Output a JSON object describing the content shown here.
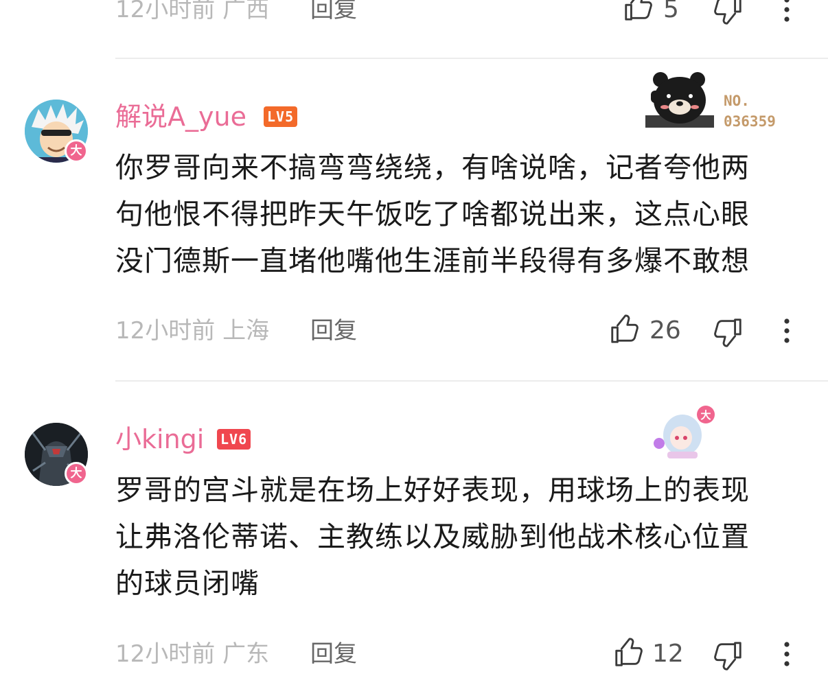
{
  "prev_comment": {
    "time": "12小时前",
    "location": "广西",
    "reply_label": "回复",
    "like_count": "5"
  },
  "comments": [
    {
      "username": "解说A_yue",
      "level": "LV5",
      "vip_badge": "大",
      "fan_label": "NO.",
      "fan_number": "036359",
      "lines": [
        "你罗哥向来不搞弯弯绕绕，有啥说啥，记者夸他两",
        "句他恨不得把昨天午饭吃了啥都说出来，这点心眼",
        "没门德斯一直堵他嘴他生涯前半段得有多爆不敢想"
      ],
      "time": "12小时前",
      "location": "上海",
      "reply_label": "回复",
      "like_count": "26"
    },
    {
      "username": "小kingi",
      "level": "LV6",
      "vip_badge": "大",
      "lines": [
        "罗哥的宫斗就是在场上好好表现，用球场上的表现",
        "让弗洛伦蒂诺、主教练以及威胁到他战术核心位置",
        "的球员闭嘴"
      ],
      "time": "12小时前",
      "location": "广东",
      "reply_label": "回复",
      "like_count": "12"
    }
  ],
  "icons": {
    "like": "thumbs-up-icon",
    "dislike": "thumbs-down-icon",
    "more": "more-vertical-icon"
  },
  "colors": {
    "username": "#ea6c96",
    "vip_badge": "#f0658e",
    "lv5": "#f36a2a",
    "lv6": "#f0474f",
    "meta_gray": "#b8b8b8"
  }
}
